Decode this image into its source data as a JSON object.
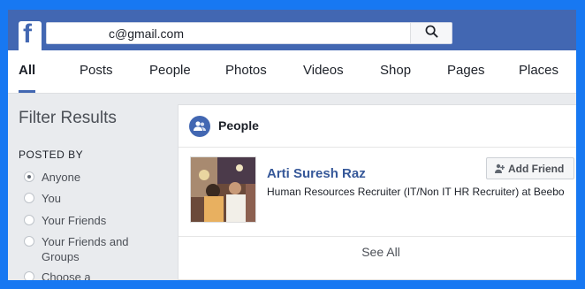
{
  "header": {
    "logo_letter": "f",
    "search_value": "c@gmail.com"
  },
  "tabs": [
    {
      "label": "All"
    },
    {
      "label": "Posts"
    },
    {
      "label": "People"
    },
    {
      "label": "Photos"
    },
    {
      "label": "Videos"
    },
    {
      "label": "Shop"
    },
    {
      "label": "Pages"
    },
    {
      "label": "Places"
    }
  ],
  "sidebar": {
    "title": "Filter Results",
    "section_label": "POSTED BY",
    "options": [
      {
        "label": "Anyone"
      },
      {
        "label": "You"
      },
      {
        "label": "Your Friends"
      },
      {
        "label": "Your Friends and Groups"
      },
      {
        "label": "Choose a Source..."
      }
    ],
    "selected": "Anyone"
  },
  "people_card": {
    "title": "People",
    "result": {
      "name": "Arti Suresh Raz",
      "subtitle": "Human Resources Recruiter (IT/Non IT HR Recruiter) at Beebo",
      "add_friend_label": "Add Friend"
    },
    "see_all_label": "See All"
  },
  "colors": {
    "brand": "#4267b2",
    "outer_border": "#1778f2",
    "link": "#365899"
  }
}
